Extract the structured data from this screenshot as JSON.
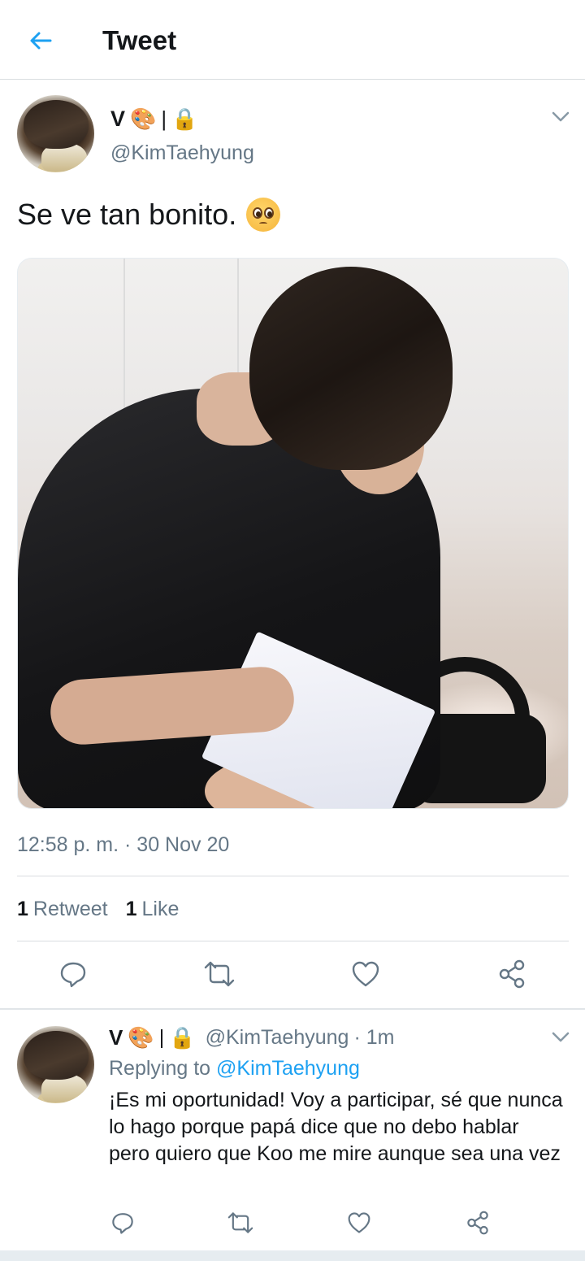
{
  "header": {
    "title": "Tweet",
    "back_icon": "arrow-left-icon",
    "accent": "#1da1f2"
  },
  "tweet": {
    "author_name": "V",
    "name_emojis": [
      "🎨",
      "|",
      "🔒"
    ],
    "handle": "@KimTaehyung",
    "text": "Se ve tan bonito.",
    "text_emoji": "pleading-face-emoji",
    "timestamp": "12:58 p. m. · 30 Nov 20",
    "stats": {
      "retweets_count": "1",
      "retweets_label": "Retweet",
      "likes_count": "1",
      "likes_label": "Like"
    },
    "actions": [
      "reply-icon",
      "retweet-icon",
      "like-icon",
      "share-icon"
    ]
  },
  "reply": {
    "author_name": "V",
    "name_emojis": [
      "🎨",
      "|",
      "🔒"
    ],
    "handle": "@KimTaehyung",
    "time": "· 1m",
    "replying_prefix": "Replying to",
    "replying_handle": "@KimTaehyung",
    "text": "¡Es mi oportunidad! Voy a participar, sé que nunca lo hago porque papá dice que no debo hablar pero quiero que Koo me mire aunque sea una vez",
    "actions": [
      "reply-icon",
      "retweet-icon",
      "like-icon",
      "share-icon"
    ]
  }
}
